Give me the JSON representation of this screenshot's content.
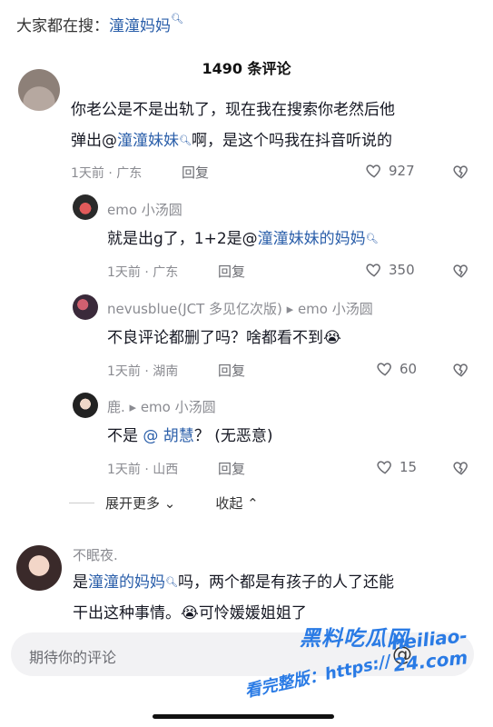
{
  "search_hint": {
    "prefix": "大家都在搜：",
    "keyword": "潼潼妈妈"
  },
  "comment_count": "1490 条评论",
  "comments": [
    {
      "line1": "你老公是不是出轨了，现在我在搜索你老然后他",
      "line2_pre": "弹出@",
      "line2_link": "潼潼妹妹",
      "line2_post": "啊，是这个吗我在抖音听说的",
      "time_loc": "1天前 · 广东",
      "reply": "回复",
      "likes": "927"
    },
    {
      "user": "emo 小汤圆",
      "text_pre": "就是出g了，1+2是@",
      "text_link": "潼潼妹妹的妈妈",
      "time_loc": "1天前 · 广东",
      "reply": "回复",
      "likes": "350"
    },
    {
      "user": "nevusblue(JCT 多见亿次版) ▸ emo 小汤圆",
      "text": "不良评论都删了吗？啥都看不到😭",
      "time_loc": "1天前 · 湖南",
      "reply": "回复",
      "likes": "60"
    },
    {
      "user": "鹿. ▸ emo 小汤圆",
      "text_pre": "不是 ",
      "text_link": "@ 胡慧",
      "text_post": "？ (无恶意)",
      "time_loc": "1天前 · 山西",
      "reply": "回复",
      "likes": "15"
    },
    {
      "user": "不眠夜.",
      "line1_pre": "是",
      "line1_link": "潼潼的妈妈",
      "line1_post": "吗，两个都是有孩子的人了还能",
      "line2": "干出这种事情。😭可怜媛媛姐姐了"
    }
  ],
  "expand_label": "展开更多",
  "collapse_label": "收起",
  "input_placeholder": "期待你的评论",
  "watermark": {
    "logo": "黑料吃瓜网",
    "site": "heiliao-24.com",
    "tag": "看完整版：https://"
  }
}
